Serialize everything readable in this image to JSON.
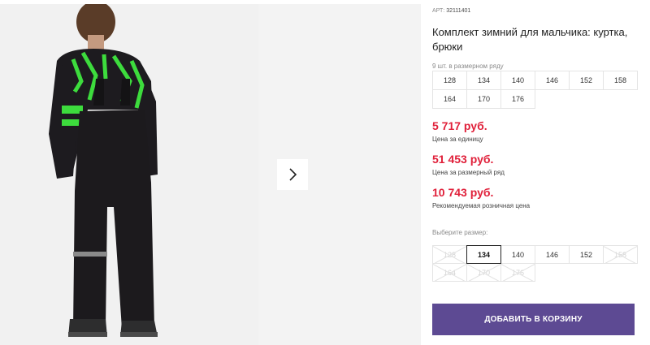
{
  "product": {
    "article_label": "АРТ:",
    "article_value": "32111401",
    "title": "Комплект зимний для мальчика: куртка, брюки",
    "pack_note": "9 шт. в размерном ряду",
    "pack_sizes": [
      "128",
      "134",
      "140",
      "146",
      "152",
      "158",
      "164",
      "170",
      "176"
    ]
  },
  "prices": [
    {
      "amount": "5 717 руб.",
      "label": "Цена за единицу"
    },
    {
      "amount": "51 453 руб.",
      "label": "Цена за размерный ряд"
    },
    {
      "amount": "10 743 руб.",
      "label": "Рекомендуемая розничная цена"
    }
  ],
  "size_picker": {
    "label": "Выберите размер:",
    "selected": "134",
    "sizes": [
      {
        "value": "128",
        "available": false
      },
      {
        "value": "134",
        "available": true
      },
      {
        "value": "140",
        "available": true
      },
      {
        "value": "146",
        "available": true
      },
      {
        "value": "152",
        "available": true
      },
      {
        "value": "158",
        "available": false
      },
      {
        "value": "164",
        "available": false
      },
      {
        "value": "170",
        "available": false
      },
      {
        "value": "176",
        "available": false
      }
    ]
  },
  "cart_button": {
    "label": "ДОБАВИТЬ В КОРЗИНУ"
  },
  "gallery": {
    "next_icon": "chevron-right-icon"
  },
  "colors": {
    "accent": "#5d4a93",
    "price": "#e0203a",
    "jacket_trim": "#3ddc3d",
    "garment": "#1c1a1d"
  }
}
